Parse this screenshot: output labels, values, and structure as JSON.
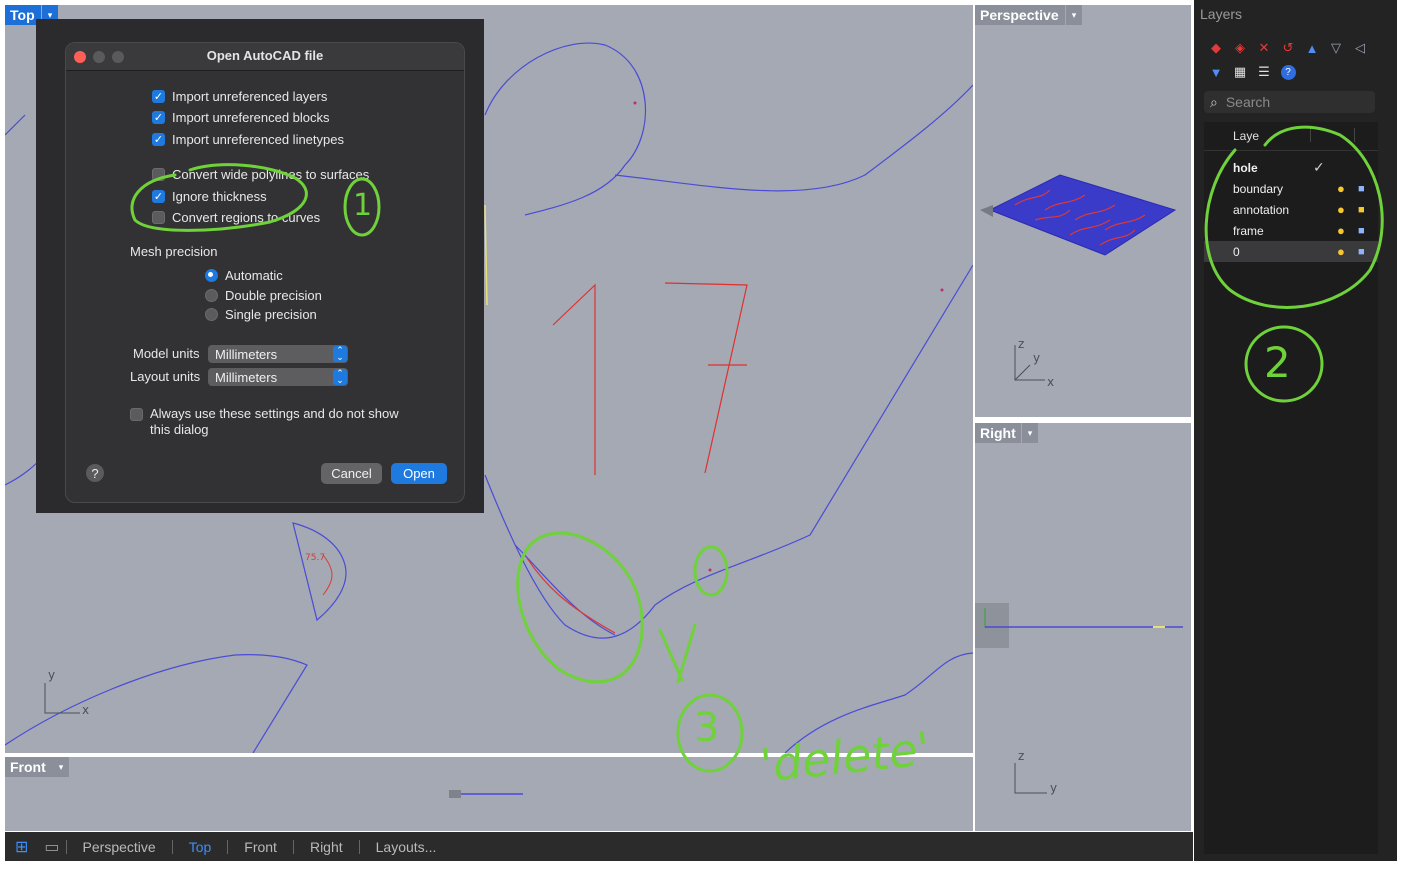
{
  "viewports": {
    "top": {
      "label": "Top"
    },
    "perspective": {
      "label": "Perspective"
    },
    "right": {
      "label": "Right"
    },
    "front": {
      "label": "Front"
    }
  },
  "axes": {
    "top": {
      "y": "y",
      "x": "x"
    },
    "perspective": {
      "z": "z",
      "y": "y",
      "x": "x"
    },
    "right": {
      "z": "z",
      "y": "y"
    }
  },
  "dialog": {
    "title": "Open AutoCAD file",
    "checkboxes": [
      {
        "label": "Import unreferenced layers",
        "checked": true
      },
      {
        "label": "Import unreferenced blocks",
        "checked": true
      },
      {
        "label": "Import unreferenced linetypes",
        "checked": true
      },
      {
        "label": "Convert wide polylines to surfaces",
        "checked": false
      },
      {
        "label": "Ignore thickness",
        "checked": true
      },
      {
        "label": "Convert regions to curves",
        "checked": false
      }
    ],
    "mesh_precision_label": "Mesh precision",
    "mesh_options": [
      {
        "label": "Automatic",
        "selected": true
      },
      {
        "label": "Double precision",
        "selected": false
      },
      {
        "label": "Single precision",
        "selected": false
      }
    ],
    "model_units_label": "Model units",
    "model_units_value": "Millimeters",
    "layout_units_label": "Layout units",
    "layout_units_value": "Millimeters",
    "always_use_line1": "Always use these settings and do not show",
    "always_use_line2": "this dialog",
    "help_label": "?",
    "cancel_label": "Cancel",
    "open_label": "Open"
  },
  "layers_panel": {
    "title": "Layers",
    "search_placeholder": "Search",
    "column_header": "Laye",
    "layers": [
      {
        "name": "hole",
        "current": true
      },
      {
        "name": "boundary",
        "current": false
      },
      {
        "name": "annotation",
        "current": false
      },
      {
        "name": "frame",
        "current": false
      },
      {
        "name": "0",
        "current": false
      }
    ],
    "toolbar_icons": [
      "new-layer-icon",
      "new-sublayer-icon",
      "delete-icon",
      "undo-icon",
      "move-up-icon",
      "move-down-icon",
      "collapse-icon",
      "filter-icon",
      "grid-icon",
      "list-icon",
      "help-icon"
    ]
  },
  "tabs": [
    "Perspective",
    "Top",
    "Front",
    "Right",
    "Layouts..."
  ],
  "active_tab": "Top",
  "annotations": {
    "mark1": "1",
    "mark2": "2",
    "mark3": "3",
    "number_drawn": "17",
    "delete_note": "'delete'"
  },
  "colors": {
    "accent": "#1f7ae0",
    "annotation_green": "#6fd23a",
    "curve_blue": "#4b4bd6",
    "curve_red": "#d93a3a"
  }
}
